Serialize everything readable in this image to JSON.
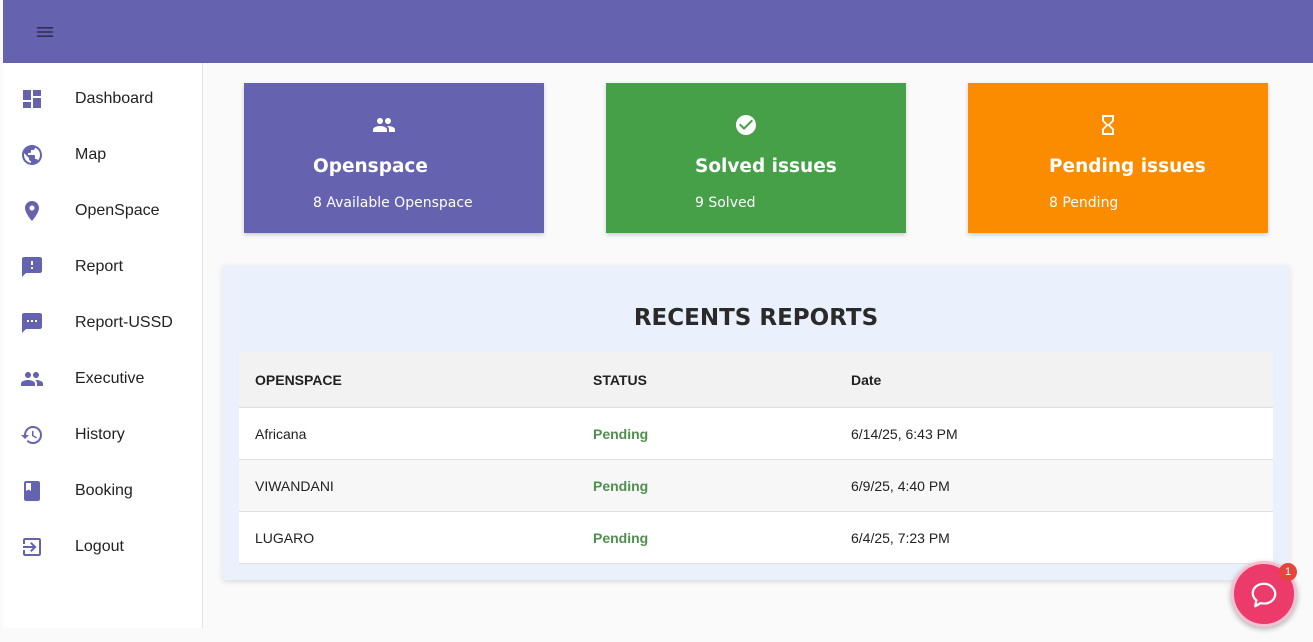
{
  "colors": {
    "topbar": "#6563b0",
    "openspace_card": "#6563b0",
    "solved_card": "#45a048",
    "pending_card": "#fb8c00",
    "status_pending": "#4f8f4f",
    "chat": "#ec3a6a"
  },
  "sidebar": {
    "items": [
      {
        "label": "Dashboard",
        "icon": "dashboard-icon"
      },
      {
        "label": "Map",
        "icon": "globe-icon"
      },
      {
        "label": "OpenSpace",
        "icon": "location-pin-icon"
      },
      {
        "label": "Report",
        "icon": "report-icon"
      },
      {
        "label": "Report-USSD",
        "icon": "sms-icon"
      },
      {
        "label": "Executive",
        "icon": "people-icon"
      },
      {
        "label": "History",
        "icon": "history-icon"
      },
      {
        "label": "Booking",
        "icon": "book-icon"
      },
      {
        "label": "Logout",
        "icon": "logout-icon"
      }
    ]
  },
  "cards": [
    {
      "title": "Openspace",
      "subtitle": "8 Available Openspace",
      "icon": "people-icon"
    },
    {
      "title": "Solved issues",
      "subtitle": "9 Solved",
      "icon": "check-circle-icon"
    },
    {
      "title": "Pending issues",
      "subtitle": "8 Pending",
      "icon": "hourglass-icon"
    }
  ],
  "reports": {
    "title": "RECENTS REPORTS",
    "columns": [
      "OPENSPACE",
      "STATUS",
      "Date"
    ],
    "rows": [
      {
        "openspace": "Africana",
        "status": "Pending",
        "date": "6/14/25, 6:43 PM"
      },
      {
        "openspace": "VIWANDANI",
        "status": "Pending",
        "date": "6/9/25, 4:40 PM"
      },
      {
        "openspace": "LUGARO",
        "status": "Pending",
        "date": "6/4/25, 7:23 PM"
      }
    ]
  },
  "chat": {
    "badge_count": "1",
    "icon": "chat-bubble-icon"
  }
}
